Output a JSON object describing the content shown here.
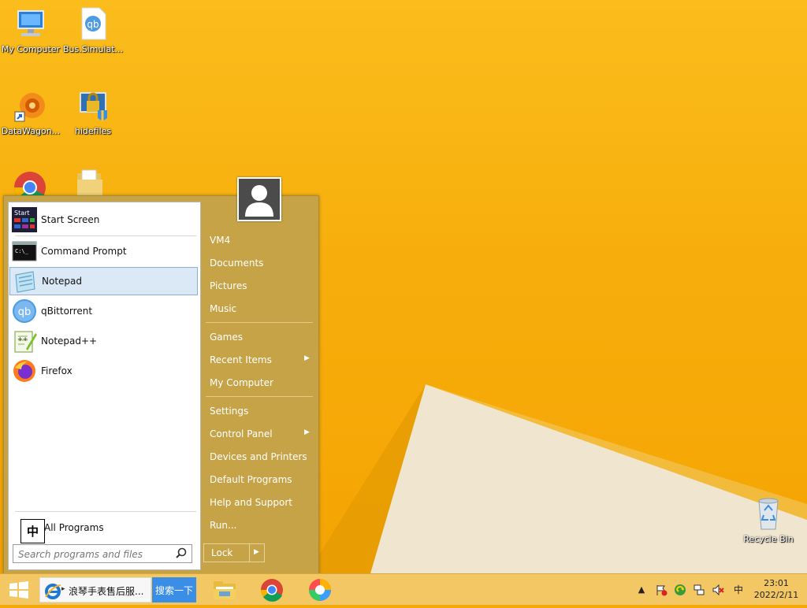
{
  "desktop": {
    "icons": [
      {
        "label": "My Computer",
        "icon": "computer-icon"
      },
      {
        "label": "Bus.Simulat...",
        "icon": "qbittorrent-file-icon"
      },
      {
        "label": "DataWagon...",
        "icon": "datawagon-shortcut-icon"
      },
      {
        "label": "hidefiles",
        "icon": "hidefiles-lock-icon"
      },
      {
        "label": "Recycle Bin",
        "icon": "recycle-bin-icon"
      }
    ]
  },
  "start_menu": {
    "programs": [
      {
        "label": "Start Screen",
        "icon": "start-screen-icon"
      },
      {
        "label": "Command Prompt",
        "icon": "command-prompt-icon"
      },
      {
        "label": "Notepad",
        "icon": "notepad-icon"
      },
      {
        "label": "qBittorrent",
        "icon": "qbittorrent-icon"
      },
      {
        "label": "Notepad++",
        "icon": "notepadpp-icon"
      },
      {
        "label": "Firefox",
        "icon": "firefox-icon"
      }
    ],
    "all_programs": "All Programs",
    "ime_indicator": "中",
    "search_placeholder": "Search programs and files",
    "right_items": [
      {
        "label": "VM4"
      },
      {
        "label": "Documents"
      },
      {
        "label": "Pictures"
      },
      {
        "label": "Music"
      },
      {
        "label": "Games"
      },
      {
        "label": "Recent Items",
        "submenu": true
      },
      {
        "label": "My Computer"
      },
      {
        "label": "Settings"
      },
      {
        "label": "Control Panel",
        "submenu": true
      },
      {
        "label": "Devices and Printers"
      },
      {
        "label": "Default Programs"
      },
      {
        "label": "Help and Support"
      },
      {
        "label": "Run..."
      }
    ],
    "lock_label": "Lock",
    "submenu_arrow": "▶"
  },
  "taskbar": {
    "ie_title": "浪琴手表售后服...",
    "search_button": "搜索一下",
    "tray_expand": "▲",
    "ime": "中",
    "time": "23:01",
    "date": "2022/2/11"
  },
  "colors": {
    "accent": "#c7a348",
    "desktop": "#f7ae0c",
    "taskbar": "#f3c763",
    "highlight": "#dbe9f7"
  }
}
